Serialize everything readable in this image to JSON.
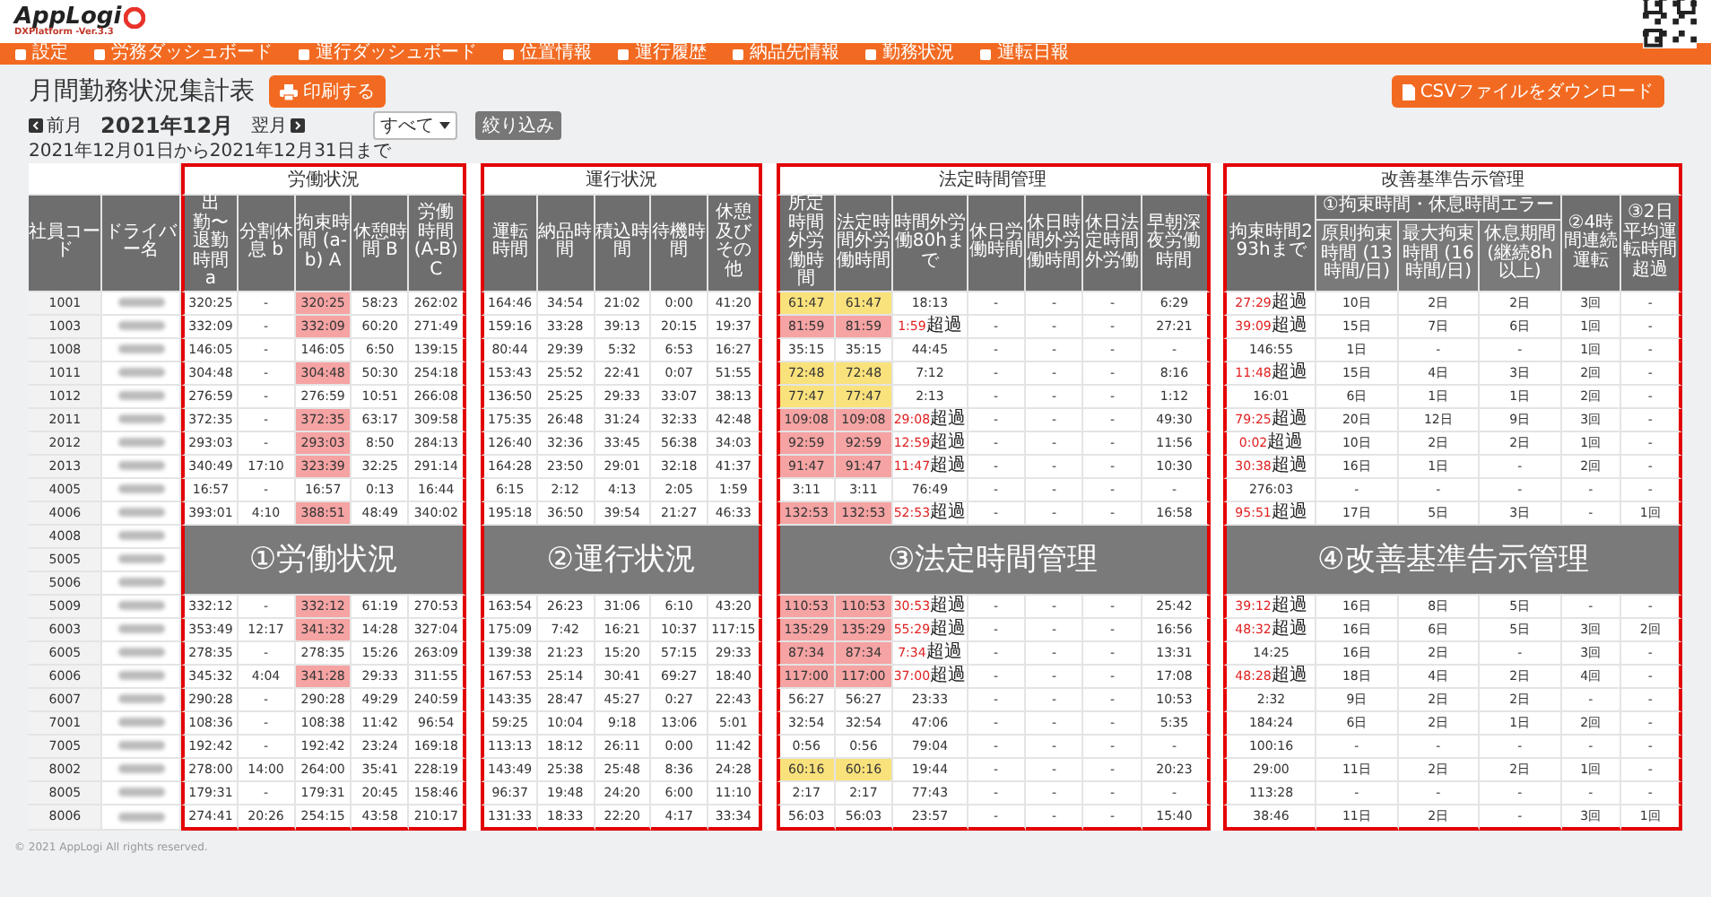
{
  "header": {
    "logo": "AppLogi",
    "version": "DXPlatform -Ver.3.3"
  },
  "nav": [
    "設定",
    "労務ダッシュボード",
    "運行ダッシュボード",
    "位置情報",
    "運行履歴",
    "納品先情報",
    "勤務状況",
    "運転日報"
  ],
  "title": "月間勤務状況集計表",
  "print_button": "印刷する",
  "csv_button": "CSVファイルをダウンロード",
  "month_nav": {
    "prev": "前月",
    "current": "2021年12月",
    "next": "翌月"
  },
  "filter": {
    "value": "すべて",
    "button": "絞り込み"
  },
  "period": "2021年12月01日から2021年12月31日まで",
  "table": {
    "fixed_columns": [
      "社員コード",
      "ドライバー名"
    ],
    "sections": [
      {
        "title": "労働状況",
        "annotation": "①労働状況",
        "columns": [
          {
            "label": "出勤〜退勤時間 a"
          },
          {
            "label": "分割休息 b"
          },
          {
            "label": "拘束時間 (a-b) A"
          },
          {
            "label": "休憩時間 B"
          },
          {
            "label": "労働時間 (A-B) C"
          }
        ]
      },
      {
        "title": "運行状況",
        "annotation": "②運行状況",
        "columns": [
          {
            "label": "運転時間"
          },
          {
            "label": "納品時間"
          },
          {
            "label": "積込時間"
          },
          {
            "label": "待機時間"
          },
          {
            "label": "休憩及びその他"
          }
        ]
      },
      {
        "title": "法定時間管理",
        "annotation": "③法定時間管理",
        "columns": [
          {
            "label": "所定時間外労働時間"
          },
          {
            "label": "法定時間外労働時間"
          },
          {
            "label": "時間外労働80hまで"
          },
          {
            "label": "休日労働時間"
          },
          {
            "label": "休日時間外労働時間"
          },
          {
            "label": "休日法定時間外労働"
          },
          {
            "label": "早朝深夜労働時間"
          }
        ]
      },
      {
        "title": "改善基準告示管理",
        "annotation": "④改善基準告示管理",
        "columns": [
          {
            "label": "拘束時間293hまで"
          },
          {
            "label": "①拘束時間・休息時間エラー",
            "children": [
              "原則拘束時間 (13時間/日)",
              "最大拘束時間 (16時間/日)",
              "休息期間 (継続8h以上)"
            ]
          },
          {
            "label": "②4時間連続運転"
          },
          {
            "label": "③2日平均運転時間超過"
          }
        ]
      }
    ],
    "rows": [
      {
        "code": "1001",
        "work": [
          "320:25",
          "-",
          "320:25",
          "58:23",
          "262:02"
        ],
        "restraint_flag": true,
        "operation": [
          "164:46",
          "34:54",
          "21:02",
          "0:00",
          "41:20"
        ],
        "legal": {
          "values": [
            "61:47",
            "61:47"
          ],
          "color": "#f9e27c"
        },
        "to80": {
          "value": "18:13"
        },
        "holiday": [
          "-",
          "-",
          "-"
        ],
        "night": "6:29",
        "to293": {
          "value": "27:29",
          "note": "超過"
        },
        "kaizen": [
          "10日",
          "2日",
          "2日",
          "3回",
          "-"
        ]
      },
      {
        "code": "1003",
        "work": [
          "332:09",
          "-",
          "332:09",
          "60:20",
          "271:49"
        ],
        "restraint_flag": true,
        "operation": [
          "159:16",
          "33:28",
          "39:13",
          "20:15",
          "19:37"
        ],
        "legal": {
          "values": [
            "81:59",
            "81:59"
          ],
          "color": "#f5a3a3"
        },
        "to80": {
          "value": "1:59",
          "note": "超過"
        },
        "holiday": [
          "-",
          "-",
          "-"
        ],
        "night": "27:21",
        "to293": {
          "value": "39:09",
          "note": "超過"
        },
        "kaizen": [
          "15日",
          "7日",
          "6日",
          "1回",
          "-"
        ]
      },
      {
        "code": "1008",
        "work": [
          "146:05",
          "-",
          "146:05",
          "6:50",
          "139:15"
        ],
        "restraint_flag": false,
        "operation": [
          "80:44",
          "29:39",
          "5:32",
          "6:53",
          "16:27"
        ],
        "legal": {
          "values": [
            "35:15",
            "35:15"
          ]
        },
        "to80": {
          "value": "44:45"
        },
        "holiday": [
          "-",
          "-",
          "-"
        ],
        "night": "-",
        "to293": {
          "value": "146:55"
        },
        "kaizen": [
          "1日",
          "-",
          "-",
          "1回",
          "-"
        ]
      },
      {
        "code": "1011",
        "work": [
          "304:48",
          "-",
          "304:48",
          "50:30",
          "254:18"
        ],
        "restraint_flag": true,
        "operation": [
          "153:43",
          "25:52",
          "22:41",
          "0:07",
          "51:55"
        ],
        "legal": {
          "values": [
            "72:48",
            "72:48"
          ],
          "color": "#f9e27c"
        },
        "to80": {
          "value": "7:12"
        },
        "holiday": [
          "-",
          "-",
          "-"
        ],
        "night": "8:16",
        "to293": {
          "value": "11:48",
          "note": "超過"
        },
        "kaizen": [
          "15日",
          "4日",
          "3日",
          "2回",
          "-"
        ]
      },
      {
        "code": "1012",
        "work": [
          "276:59",
          "-",
          "276:59",
          "10:51",
          "266:08"
        ],
        "restraint_flag": false,
        "operation": [
          "136:50",
          "25:25",
          "29:33",
          "33:07",
          "38:13"
        ],
        "legal": {
          "values": [
            "77:47",
            "77:47"
          ],
          "color": "#f9e27c"
        },
        "to80": {
          "value": "2:13"
        },
        "holiday": [
          "-",
          "-",
          "-"
        ],
        "night": "1:12",
        "to293": {
          "value": "16:01"
        },
        "kaizen": [
          "6日",
          "1日",
          "1日",
          "2回",
          "-"
        ]
      },
      {
        "code": "2011",
        "work": [
          "372:35",
          "-",
          "372:35",
          "63:17",
          "309:58"
        ],
        "restraint_flag": true,
        "operation": [
          "175:35",
          "26:48",
          "31:24",
          "32:33",
          "42:48"
        ],
        "legal": {
          "values": [
            "109:08",
            "109:08"
          ],
          "color": "#f5a3a3"
        },
        "to80": {
          "value": "29:08",
          "note": "超過"
        },
        "holiday": [
          "-",
          "-",
          "-"
        ],
        "night": "49:30",
        "to293": {
          "value": "79:25",
          "note": "超過"
        },
        "kaizen": [
          "20日",
          "12日",
          "9日",
          "3回",
          "-"
        ]
      },
      {
        "code": "2012",
        "work": [
          "293:03",
          "-",
          "293:03",
          "8:50",
          "284:13"
        ],
        "restraint_flag": true,
        "operation": [
          "126:40",
          "32:36",
          "33:45",
          "56:38",
          "34:03"
        ],
        "legal": {
          "values": [
            "92:59",
            "92:59"
          ],
          "color": "#f5a3a3"
        },
        "to80": {
          "value": "12:59",
          "note": "超過"
        },
        "holiday": [
          "-",
          "-",
          "-"
        ],
        "night": "11:56",
        "to293": {
          "value": "0:02",
          "note": "超過"
        },
        "kaizen": [
          "10日",
          "2日",
          "2日",
          "1回",
          "-"
        ]
      },
      {
        "code": "2013",
        "work": [
          "340:49",
          "17:10",
          "323:39",
          "32:25",
          "291:14"
        ],
        "restraint_flag": true,
        "operation": [
          "164:28",
          "23:50",
          "29:01",
          "32:18",
          "41:37"
        ],
        "legal": {
          "values": [
            "91:47",
            "91:47"
          ],
          "color": "#f5a3a3"
        },
        "to80": {
          "value": "11:47",
          "note": "超過"
        },
        "holiday": [
          "-",
          "-",
          "-"
        ],
        "night": "10:30",
        "to293": {
          "value": "30:38",
          "note": "超過"
        },
        "kaizen": [
          "16日",
          "1日",
          "-",
          "2回",
          "-"
        ]
      },
      {
        "code": "4005",
        "work": [
          "16:57",
          "-",
          "16:57",
          "0:13",
          "16:44"
        ],
        "restraint_flag": false,
        "operation": [
          "6:15",
          "2:12",
          "4:13",
          "2:05",
          "1:59"
        ],
        "legal": {
          "values": [
            "3:11",
            "3:11"
          ]
        },
        "to80": {
          "value": "76:49"
        },
        "holiday": [
          "-",
          "-",
          "-"
        ],
        "night": "-",
        "to293": {
          "value": "276:03"
        },
        "kaizen": [
          "-",
          "-",
          "-",
          "-",
          "-"
        ]
      },
      {
        "code": "4006",
        "work": [
          "393:01",
          "4:10",
          "388:51",
          "48:49",
          "340:02"
        ],
        "restraint_flag": true,
        "operation": [
          "195:18",
          "36:50",
          "39:54",
          "21:27",
          "46:33"
        ],
        "legal": {
          "values": [
            "132:53",
            "132:53"
          ],
          "color": "#f5a3a3"
        },
        "to80": {
          "value": "52:53",
          "note": "超過"
        },
        "holiday": [
          "-",
          "-",
          "-"
        ],
        "night": "16:58",
        "to293": {
          "value": "95:51",
          "note": "超過"
        },
        "kaizen": [
          "17日",
          "5日",
          "3日",
          "-",
          "1回"
        ]
      },
      {
        "code": "4008"
      },
      {
        "code": "5005"
      },
      {
        "code": "5006"
      },
      {
        "code": "5009",
        "work": [
          "332:12",
          "-",
          "332:12",
          "61:19",
          "270:53"
        ],
        "restraint_flag": true,
        "operation": [
          "163:54",
          "26:23",
          "31:06",
          "6:10",
          "43:20"
        ],
        "legal": {
          "values": [
            "110:53",
            "110:53"
          ],
          "color": "#f5a3a3"
        },
        "to80": {
          "value": "30:53",
          "note": "超過"
        },
        "holiday": [
          "-",
          "-",
          "-"
        ],
        "night": "25:42",
        "to293": {
          "value": "39:12",
          "note": "超過"
        },
        "kaizen": [
          "16日",
          "8日",
          "5日",
          "-",
          "-"
        ]
      },
      {
        "code": "6003",
        "work": [
          "353:49",
          "12:17",
          "341:32",
          "14:28",
          "327:04"
        ],
        "restraint_flag": true,
        "operation": [
          "175:09",
          "7:42",
          "16:21",
          "10:37",
          "117:15"
        ],
        "legal": {
          "values": [
            "135:29",
            "135:29"
          ],
          "color": "#f5a3a3"
        },
        "to80": {
          "value": "55:29",
          "note": "超過"
        },
        "holiday": [
          "-",
          "-",
          "-"
        ],
        "night": "16:56",
        "to293": {
          "value": "48:32",
          "note": "超過"
        },
        "kaizen": [
          "16日",
          "6日",
          "5日",
          "3回",
          "2回"
        ]
      },
      {
        "code": "6005",
        "work": [
          "278:35",
          "-",
          "278:35",
          "15:26",
          "263:09"
        ],
        "restraint_flag": false,
        "operation": [
          "139:38",
          "21:23",
          "15:20",
          "57:15",
          "29:33"
        ],
        "legal": {
          "values": [
            "87:34",
            "87:34"
          ],
          "color": "#f5a3a3"
        },
        "to80": {
          "value": "7:34",
          "note": "超過"
        },
        "holiday": [
          "-",
          "-",
          "-"
        ],
        "night": "13:31",
        "to293": {
          "value": "14:25"
        },
        "kaizen": [
          "16日",
          "2日",
          "-",
          "3回",
          "-"
        ]
      },
      {
        "code": "6006",
        "work": [
          "345:32",
          "4:04",
          "341:28",
          "29:33",
          "311:55"
        ],
        "restraint_flag": true,
        "operation": [
          "167:53",
          "25:14",
          "30:41",
          "69:27",
          "18:40"
        ],
        "legal": {
          "values": [
            "117:00",
            "117:00"
          ],
          "color": "#f5a3a3"
        },
        "to80": {
          "value": "37:00",
          "note": "超過"
        },
        "holiday": [
          "-",
          "-",
          "-"
        ],
        "night": "17:08",
        "to293": {
          "value": "48:28",
          "note": "超過"
        },
        "kaizen": [
          "18日",
          "4日",
          "2日",
          "4回",
          "-"
        ]
      },
      {
        "code": "6007",
        "work": [
          "290:28",
          "-",
          "290:28",
          "49:29",
          "240:59"
        ],
        "restraint_flag": false,
        "operation": [
          "143:35",
          "28:47",
          "45:27",
          "0:27",
          "22:43"
        ],
        "legal": {
          "values": [
            "56:27",
            "56:27"
          ]
        },
        "to80": {
          "value": "23:33"
        },
        "holiday": [
          "-",
          "-",
          "-"
        ],
        "night": "10:53",
        "to293": {
          "value": "2:32"
        },
        "kaizen": [
          "9日",
          "2日",
          "2日",
          "-",
          "-"
        ]
      },
      {
        "code": "7001",
        "work": [
          "108:36",
          "-",
          "108:38",
          "11:42",
          "96:54"
        ],
        "restraint_flag": false,
        "operation": [
          "59:25",
          "10:04",
          "9:18",
          "13:06",
          "5:01"
        ],
        "legal": {
          "values": [
            "32:54",
            "32:54"
          ]
        },
        "to80": {
          "value": "47:06"
        },
        "holiday": [
          "-",
          "-",
          "-"
        ],
        "night": "5:35",
        "to293": {
          "value": "184:24"
        },
        "kaizen": [
          "6日",
          "2日",
          "1日",
          "2回",
          "-"
        ]
      },
      {
        "code": "7005",
        "work": [
          "192:42",
          "-",
          "192:42",
          "23:24",
          "169:18"
        ],
        "restraint_flag": false,
        "operation": [
          "113:13",
          "18:12",
          "26:11",
          "0:00",
          "11:42"
        ],
        "legal": {
          "values": [
            "0:56",
            "0:56"
          ]
        },
        "to80": {
          "value": "79:04"
        },
        "holiday": [
          "-",
          "-",
          "-"
        ],
        "night": "-",
        "to293": {
          "value": "100:16"
        },
        "kaizen": [
          "-",
          "-",
          "-",
          "-",
          "-"
        ]
      },
      {
        "code": "8002",
        "work": [
          "278:00",
          "14:00",
          "264:00",
          "35:41",
          "228:19"
        ],
        "restraint_flag": false,
        "operation": [
          "143:49",
          "25:38",
          "25:48",
          "8:36",
          "24:28"
        ],
        "legal": {
          "values": [
            "60:16",
            "60:16"
          ],
          "color": "#f9e27c"
        },
        "to80": {
          "value": "19:44"
        },
        "holiday": [
          "-",
          "-",
          "-"
        ],
        "night": "20:23",
        "to293": {
          "value": "29:00"
        },
        "kaizen": [
          "11日",
          "2日",
          "2日",
          "1回",
          "-"
        ]
      },
      {
        "code": "8005",
        "work": [
          "179:31",
          "-",
          "179:31",
          "20:45",
          "158:46"
        ],
        "restraint_flag": false,
        "operation": [
          "96:37",
          "19:48",
          "24:20",
          "6:00",
          "11:10"
        ],
        "legal": {
          "values": [
            "2:17",
            "2:17"
          ]
        },
        "to80": {
          "value": "77:43"
        },
        "holiday": [
          "-",
          "-",
          "-"
        ],
        "night": "-",
        "to293": {
          "value": "113:28"
        },
        "kaizen": [
          "-",
          "-",
          "-",
          "-",
          "-"
        ]
      },
      {
        "code": "8006",
        "work": [
          "274:41",
          "20:26",
          "254:15",
          "43:58",
          "210:17"
        ],
        "restraint_flag": false,
        "operation": [
          "131:33",
          "18:33",
          "22:20",
          "4:17",
          "33:34"
        ],
        "legal": {
          "values": [
            "56:03",
            "56:03"
          ]
        },
        "to80": {
          "value": "23:57"
        },
        "holiday": [
          "-",
          "-",
          "-"
        ],
        "night": "15:40",
        "to293": {
          "value": "38:46"
        },
        "kaizen": [
          "11日",
          "2日",
          "-",
          "3回",
          "1回"
        ]
      }
    ]
  },
  "footer": "© 2021 AppLogi All rights reserved."
}
